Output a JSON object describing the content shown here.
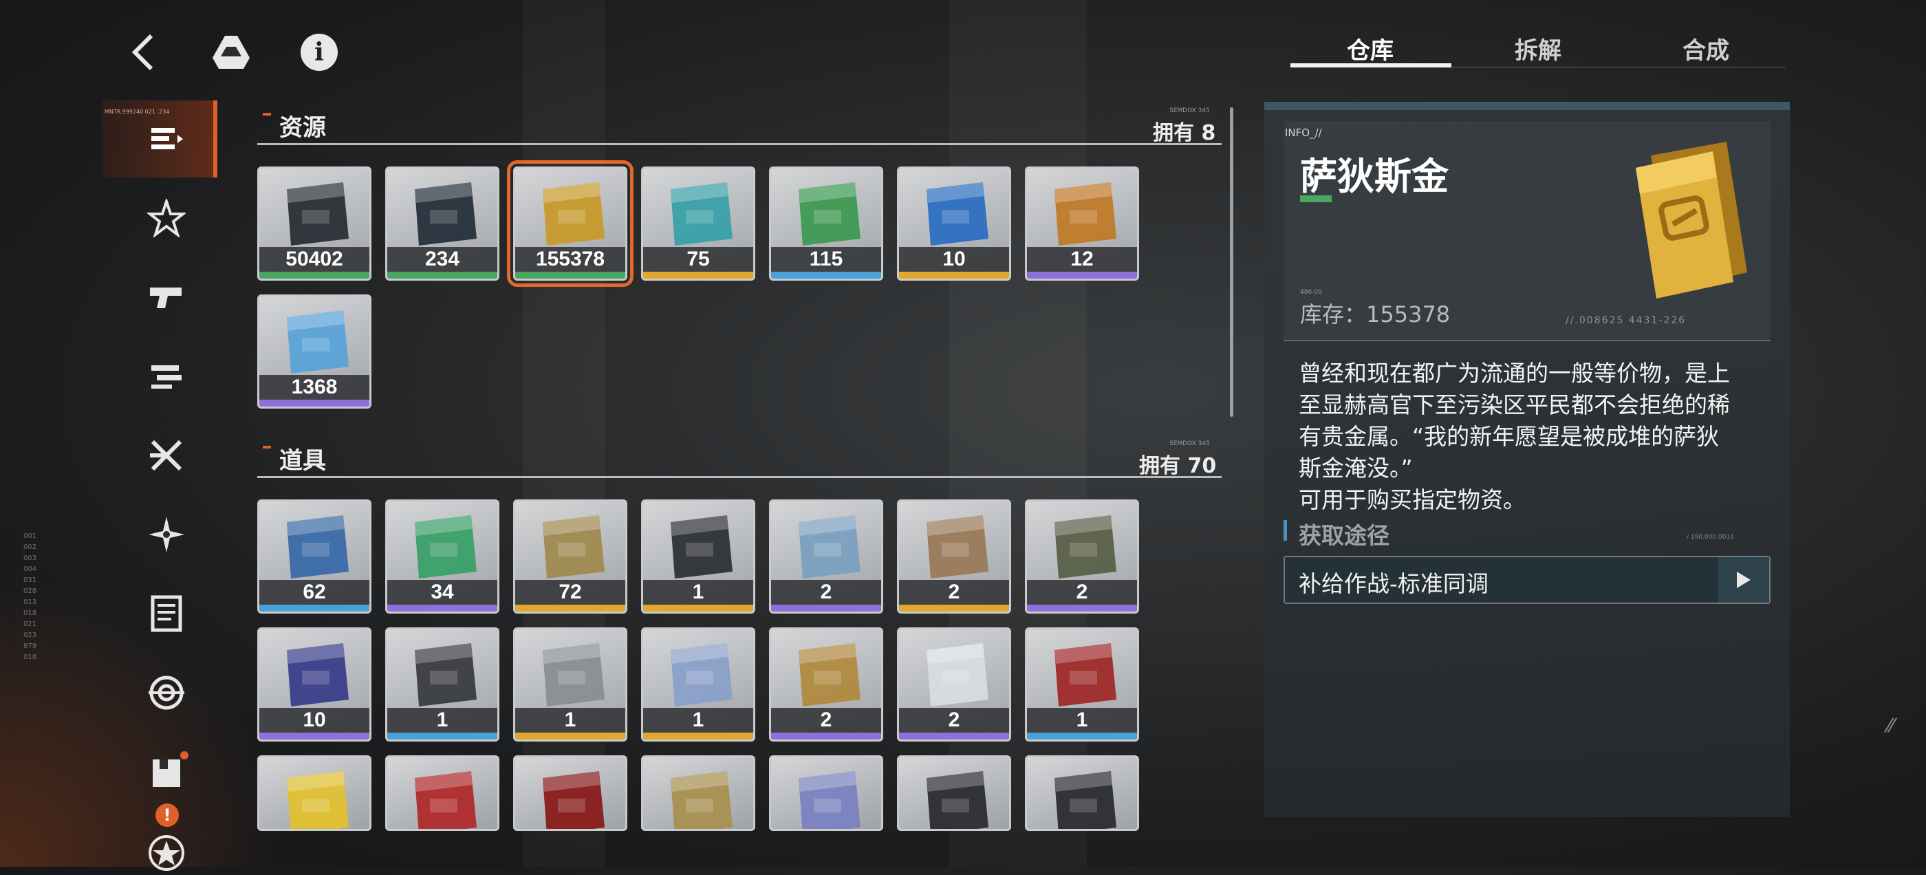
{
  "top_bar": {
    "back_icon": "chevron-left-icon",
    "drive_icon": "triangle-drive-icon",
    "info_icon": "info-icon",
    "info_glyph": "i"
  },
  "tabs": [
    {
      "label": "仓库",
      "active": true
    },
    {
      "label": "拆解",
      "active": false
    },
    {
      "label": "合成",
      "active": false
    }
  ],
  "sidebar": {
    "active_tiny_text": "MNTR.999240 021 .234",
    "warn_badge": "!",
    "items": [
      {
        "name": "resources",
        "icon": "list-icon",
        "active": true
      },
      {
        "name": "dolls",
        "icon": "star-sigil-icon"
      },
      {
        "name": "weapons",
        "icon": "pistol-icon"
      },
      {
        "name": "parts",
        "icon": "attachment-icon"
      },
      {
        "name": "skills",
        "icon": "x-sigil-icon"
      },
      {
        "name": "materials",
        "icon": "shuriken-icon"
      },
      {
        "name": "documents",
        "icon": "document-icon"
      },
      {
        "name": "target",
        "icon": "target-icon"
      },
      {
        "name": "boxes",
        "icon": "box-icon",
        "badge": true
      },
      {
        "name": "medal",
        "icon": "star-circle-icon"
      }
    ]
  },
  "sections": {
    "resources": {
      "title": "资源",
      "count": "拥有 8",
      "sub": "SEMDOX 345",
      "items": [
        {
          "qty": "50402",
          "rarity": "#4aa661",
          "icon": "card-item-icon",
          "hue": "#2b2f36"
        },
        {
          "qty": "234",
          "rarity": "#4aa661",
          "icon": "dna-card-icon",
          "hue": "#26303c"
        },
        {
          "qty": "155378",
          "rarity": "#4aa661",
          "icon": "gold-bar-icon",
          "hue": "#c79a2b",
          "selected": true
        },
        {
          "qty": "75",
          "rarity": "#e0a82e",
          "icon": "crystal-icon",
          "hue": "#3aa0a8"
        },
        {
          "qty": "115",
          "rarity": "#4aa0d8",
          "icon": "ticket-icon",
          "hue": "#3e9a52"
        },
        {
          "qty": "10",
          "rarity": "#e0a82e",
          "icon": "coin-icon",
          "hue": "#2c6fc2"
        },
        {
          "qty": "12",
          "rarity": "#8f6fd8",
          "icon": "triangle-token-icon",
          "hue": "#c07a2a"
        },
        {
          "qty": "1368",
          "rarity": "#8f6fd8",
          "icon": "pass-card-icon",
          "hue": "#5aa3d8"
        }
      ]
    },
    "props": {
      "title": "道具",
      "count": "拥有 70",
      "sub": "SEMDOX 345",
      "items": [
        {
          "qty": "62",
          "rarity": "#4aa0d8",
          "icon": "data-card-blue-icon",
          "hue": "#3a6aa8"
        },
        {
          "qty": "34",
          "rarity": "#8f6fd8",
          "icon": "data-card-green-icon",
          "hue": "#3aa068"
        },
        {
          "qty": "72",
          "rarity": "#e0a82e",
          "icon": "data-card-gold-icon",
          "hue": "#a08a50"
        },
        {
          "qty": "1",
          "rarity": "#e0a82e",
          "icon": "console-icon",
          "hue": "#2e3136"
        },
        {
          "qty": "2",
          "rarity": "#8f6fd8",
          "icon": "vr-headset-icon",
          "hue": "#7aa0c0"
        },
        {
          "qty": "2",
          "rarity": "#e0a82e",
          "icon": "tickets-icon",
          "hue": "#9a7a5a"
        },
        {
          "qty": "2",
          "rarity": "#8f6fd8",
          "icon": "vehicle-model-icon",
          "hue": "#5a6048"
        },
        {
          "qty": "10",
          "rarity": "#8f6fd8",
          "icon": "concert-ticket-icon",
          "hue": "#3a3e8a"
        },
        {
          "qty": "1",
          "rarity": "#4aa0d8",
          "icon": "robot-pet-icon",
          "hue": "#3a3c40"
        },
        {
          "qty": "1",
          "rarity": "#e0a82e",
          "icon": "canned-food-icon",
          "hue": "#8a8e94"
        },
        {
          "qty": "1",
          "rarity": "#e0a82e",
          "icon": "teapot-icon",
          "hue": "#8aa0c8"
        },
        {
          "qty": "2",
          "rarity": "#8f6fd8",
          "icon": "hand-mirror-icon",
          "hue": "#b08a40"
        },
        {
          "qty": "2",
          "rarity": "#8f6fd8",
          "icon": "gadget-box-icon",
          "hue": "#d8dce0"
        },
        {
          "qty": "1",
          "rarity": "#4aa0d8",
          "icon": "fountain-pen-icon",
          "hue": "#a02a2a"
        },
        {
          "qty": "",
          "rarity": "",
          "icon": "jar-icon",
          "hue": "#e0c030"
        },
        {
          "qty": "",
          "rarity": "",
          "icon": "lighter-icon",
          "hue": "#b02a2a"
        },
        {
          "qty": "",
          "rarity": "",
          "icon": "ring-box-icon",
          "hue": "#8a1a1a"
        },
        {
          "qty": "",
          "rarity": "",
          "icon": "chain-necklace-icon",
          "hue": "#a89050"
        },
        {
          "qty": "",
          "rarity": "",
          "icon": "earrings-icon",
          "hue": "#7a82c0"
        },
        {
          "qty": "",
          "rarity": "",
          "icon": "bracelet-icon",
          "hue": "#2a2c30"
        },
        {
          "qty": "",
          "rarity": "",
          "icon": "spiked-choker-icon",
          "hue": "#2a2c30"
        }
      ]
    }
  },
  "detail": {
    "info_tag": "INFO_//",
    "title": "萨狄斯金",
    "stock_tiny": "486-00",
    "stock_label": "库存：155378",
    "code": "//.008625   4431-226",
    "description": [
      "曾经和现在都广为流通的一般等价物，是上",
      "至显赫高官下至污染区平民都不会拒绝的稀",
      "有贵金属。“我的新年愿望是被成堆的萨狄",
      "斯金淹没。”",
      "可用于购买指定物资。"
    ],
    "source_title": "获取途径",
    "source_code": "/ 190.000.0011",
    "sources": [
      {
        "label": "补给作战-标准同调",
        "icon": "play-icon"
      }
    ]
  },
  "deco": {
    "left_codes": [
      "001",
      "002",
      "003",
      "004",
      "031",
      "028",
      "013",
      "018",
      "021",
      "023",
      "879",
      "018"
    ]
  },
  "colors": {
    "accent": "#e0602a",
    "green": "#4aa661",
    "gold": "#e0a82e",
    "blue": "#4aa0d8",
    "purple": "#8f6fd8"
  }
}
